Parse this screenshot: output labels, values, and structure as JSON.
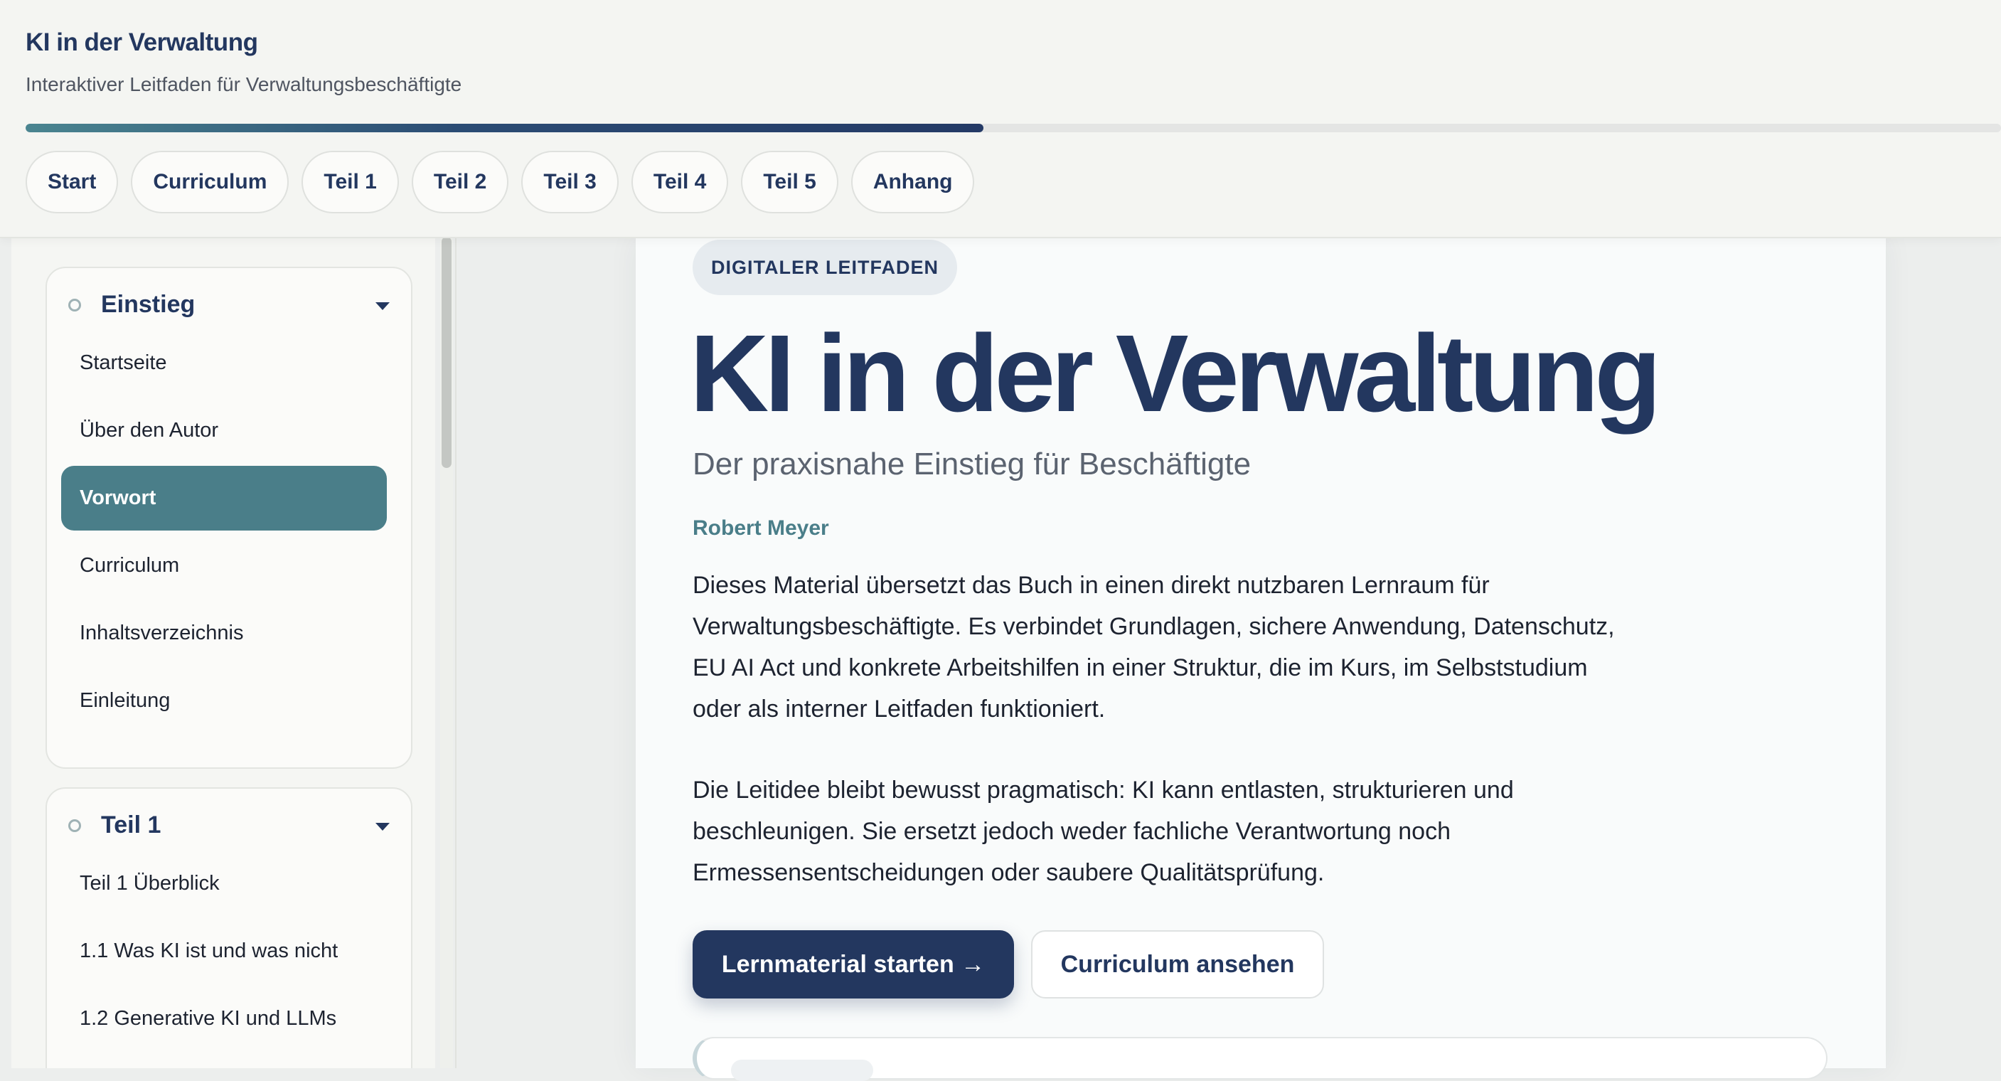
{
  "header": {
    "title": "KI in der Verwaltung",
    "subtitle": "Interaktiver Leitfaden für Verwaltungsbeschäftigte",
    "progress_percent": 48.5,
    "tabs": [
      {
        "label": "Start"
      },
      {
        "label": "Curriculum"
      },
      {
        "label": "Teil 1"
      },
      {
        "label": "Teil 2"
      },
      {
        "label": "Teil 3"
      },
      {
        "label": "Teil 4"
      },
      {
        "label": "Teil 5"
      },
      {
        "label": "Anhang"
      }
    ]
  },
  "sidebar": {
    "groups": [
      {
        "title": "Einstieg",
        "items": [
          {
            "label": "Startseite",
            "active": false
          },
          {
            "label": "Über den Autor",
            "active": false
          },
          {
            "label": "Vorwort",
            "active": true
          },
          {
            "label": "Curriculum",
            "active": false
          },
          {
            "label": "Inhaltsverzeichnis",
            "active": false
          },
          {
            "label": "Einleitung",
            "active": false
          }
        ]
      },
      {
        "title": "Teil 1",
        "items": [
          {
            "label": "Teil 1 Überblick",
            "active": false
          },
          {
            "label": "1.1 Was KI ist und was nicht",
            "active": false
          },
          {
            "label": "1.2 Generative KI und LLMs",
            "active": false
          }
        ]
      }
    ]
  },
  "main": {
    "badge": "DIGITALER LEITFADEN",
    "title": "KI in der Verwaltung",
    "subtitle": "Der praxisnahe Einstieg für Beschäftigte",
    "author": "Robert Meyer",
    "paragraphs": [
      "Dieses Material übersetzt das Buch in einen direkt nutzbaren Lernraum für Verwaltungsbeschäftigte. Es verbindet Grundlagen, sichere Anwendung, Datenschutz, EU AI Act und konkrete Arbeitshilfen in einer Struktur, die im Kurs, im Selbststudium oder als interner Leitfaden funktioniert.",
      "Die Leitidee bleibt bewusst pragmatisch: KI kann entlasten, strukturieren und beschleunigen. Sie ersetzt jedoch weder fachliche Verantwortung noch Ermessensentscheidungen oder saubere Qualitätsprüfung."
    ],
    "primary_button": "Lernmaterial starten →",
    "secondary_button": "Curriculum ansehen"
  },
  "colors": {
    "brand_navy": "#23375f",
    "accent_teal": "#4a7e89",
    "background": "#eceeed"
  }
}
